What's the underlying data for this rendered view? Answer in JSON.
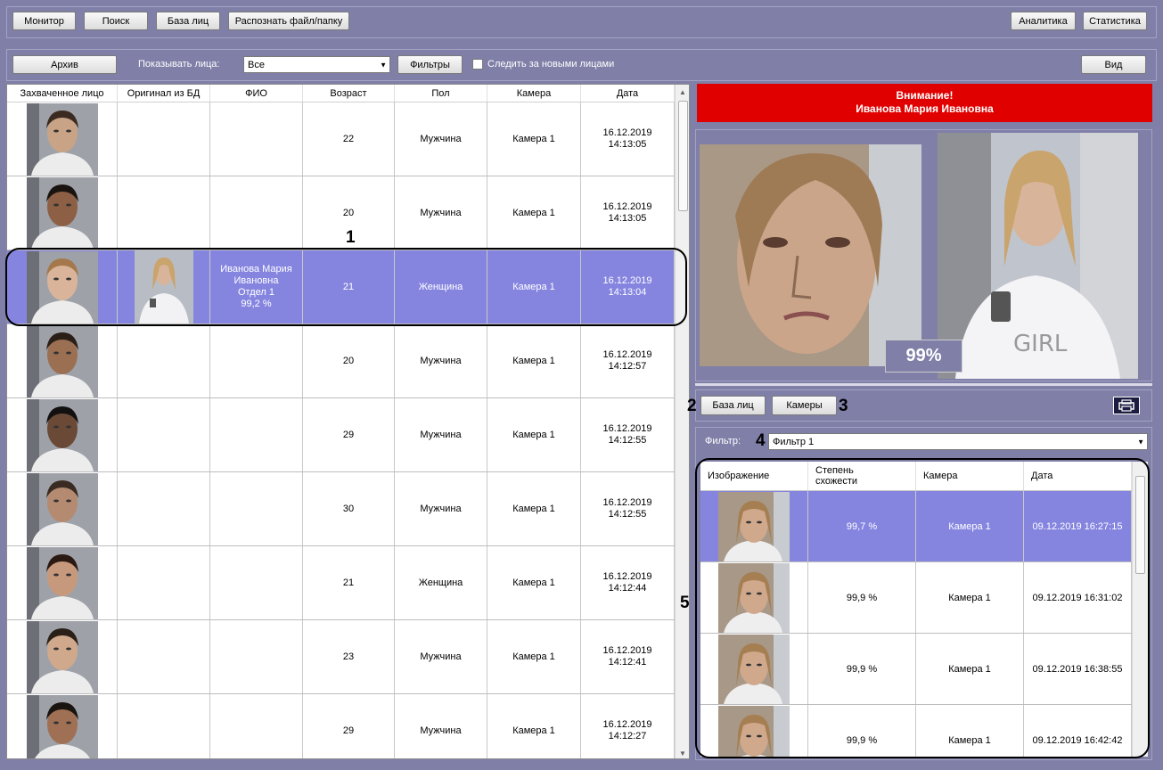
{
  "toolbar": {
    "monitor": "Монитор",
    "search": "Поиск",
    "face_db": "База лиц",
    "recognize": "Распознать файл/папку",
    "analytics": "Аналитика",
    "statistics": "Статистика"
  },
  "toolbar2": {
    "archive": "Архив",
    "show_faces_label": "Показывать лица:",
    "show_faces_value": "Все",
    "filters": "Фильтры",
    "follow_new": "Следить за новыми лицами",
    "view": "Вид"
  },
  "left_table": {
    "headers": [
      "Захваченное лицо",
      "Оригинал из БД",
      "ФИО",
      "Возраст",
      "Пол",
      "Камера",
      "Дата"
    ],
    "rows": [
      {
        "fio": "",
        "age": "22",
        "sex": "Мужчина",
        "camera": "Камера 1",
        "date": "16.12.2019",
        "time": "14:13:05",
        "selected": false
      },
      {
        "fio": "",
        "age": "20",
        "sex": "Мужчина",
        "camera": "Камера 1",
        "date": "16.12.2019",
        "time": "14:13:05",
        "selected": false
      },
      {
        "fio": "Иванова Мария\nИвановна\nОтдел 1\n99,2 %",
        "age": "21",
        "sex": "Женщина",
        "camera": "Камера 1",
        "date": "16.12.2019",
        "time": "14:13:04",
        "selected": true
      },
      {
        "fio": "",
        "age": "20",
        "sex": "Мужчина",
        "camera": "Камера 1",
        "date": "16.12.2019",
        "time": "14:12:57",
        "selected": false
      },
      {
        "fio": "",
        "age": "29",
        "sex": "Мужчина",
        "camera": "Камера 1",
        "date": "16.12.2019",
        "time": "14:12:55",
        "selected": false
      },
      {
        "fio": "",
        "age": "30",
        "sex": "Мужчина",
        "camera": "Камера 1",
        "date": "16.12.2019",
        "time": "14:12:55",
        "selected": false
      },
      {
        "fio": "",
        "age": "21",
        "sex": "Женщина",
        "camera": "Камера 1",
        "date": "16.12.2019",
        "time": "14:12:44",
        "selected": false
      },
      {
        "fio": "",
        "age": "23",
        "sex": "Мужчина",
        "camera": "Камера 1",
        "date": "16.12.2019",
        "time": "14:12:41",
        "selected": false
      },
      {
        "fio": "",
        "age": "29",
        "sex": "Мужчина",
        "camera": "Камера 1",
        "date": "16.12.2019",
        "time": "14:12:27",
        "selected": false
      }
    ]
  },
  "alert": {
    "line1": "Внимание!",
    "line2": "Иванова Мария Ивановна"
  },
  "compare": {
    "percent": "99%"
  },
  "tabs": {
    "face_db": "База лиц",
    "cameras": "Камеры"
  },
  "filter": {
    "label": "Фильтр:",
    "value": "Фильтр 1"
  },
  "right_table": {
    "headers": [
      "Изображение",
      "Степень\nсхожести",
      "Камера",
      "Дата"
    ],
    "rows": [
      {
        "similarity": "99,7 %",
        "camera": "Камера 1",
        "date": "09.12.2019 16:27:15",
        "selected": true
      },
      {
        "similarity": "99,9 %",
        "camera": "Камера 1",
        "date": "09.12.2019 16:31:02",
        "selected": false
      },
      {
        "similarity": "99,9 %",
        "camera": "Камера 1",
        "date": "09.12.2019 16:38:55",
        "selected": false
      },
      {
        "similarity": "99,9 %",
        "camera": "Камера 1",
        "date": "09.12.2019 16:42:42",
        "selected": false
      }
    ]
  },
  "callouts": [
    "1",
    "2",
    "3",
    "4",
    "5"
  ],
  "colors": {
    "background": "#7f7fa8",
    "selection": "#8585e0",
    "alert": "#e00000"
  }
}
